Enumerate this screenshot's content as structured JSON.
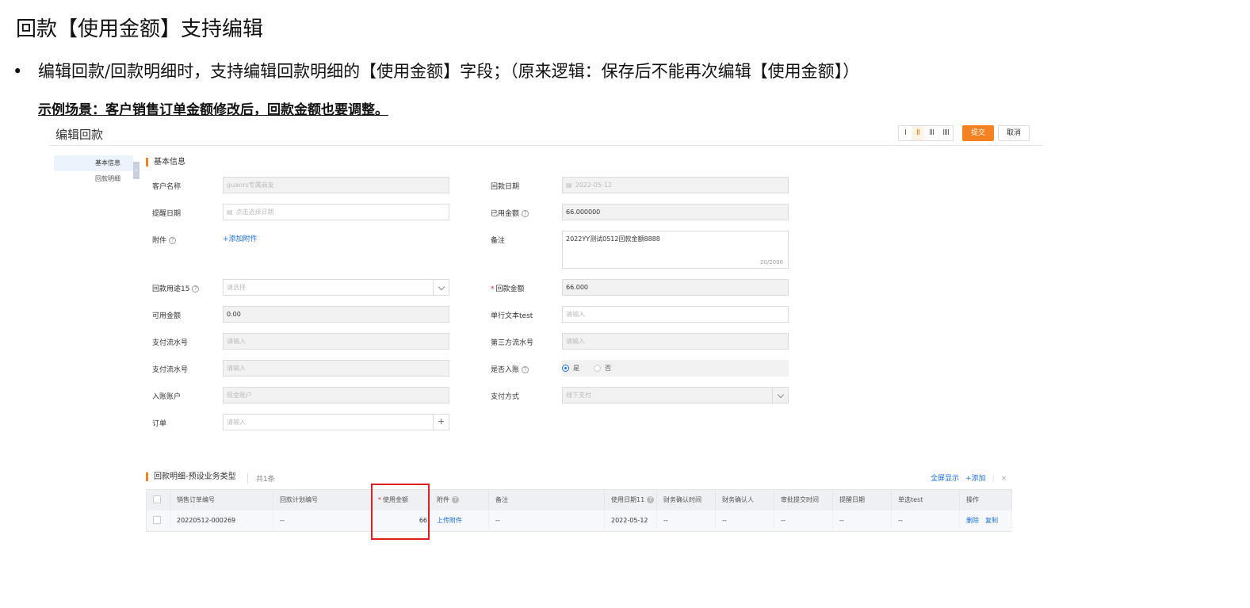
{
  "doc": {
    "title": "回款【使用金额】支持编辑",
    "bullet_symbol": "•",
    "bullet_text": "编辑回款/回款明细时，支持编辑回款明细的【使用金额】字段；（原来逻辑：保存后不能再次编辑【使用金额】）",
    "scenario": "示例场景：客户销售订单金额修改后，回款金额也要调整。"
  },
  "app": {
    "title": "编辑回款",
    "layout_options": [
      "I",
      "II",
      "III",
      "IIII"
    ],
    "submit_label": "提交",
    "cancel_label": "取消",
    "side_nav": [
      "基本信息",
      "回款明细"
    ],
    "collapse_glyph": "‹",
    "section_basic": "基本信息",
    "fields": {
      "customer_label": "客户名称",
      "customer_value": "guanrs专属商友",
      "payment_date_label": "回款日期",
      "payment_date_value": "2022-05-12",
      "remind_date_label": "提醒日期",
      "remind_date_placeholder": "点击选择日期",
      "used_amount_label": "已用金额",
      "used_amount_value": "66.000000",
      "attachment_label": "附件",
      "attachment_link": "+添加附件",
      "remark_label": "备注",
      "remark_value": "2022YY测试0512回款金额8888",
      "remark_count": "20/2000",
      "purpose_label": "回款用途15",
      "purpose_placeholder": "请选择",
      "amount_label": "回款金额",
      "amount_value": "66.000",
      "available_label": "可用金额",
      "available_value": "0.00",
      "single_text_label": "单行文本test",
      "single_text_placeholder": "请输入",
      "pay_serial_label": "支付流水号",
      "pay_serial_placeholder": "请输入",
      "third_serial_label": "第三方流水号",
      "third_serial_placeholder": "请输入",
      "pay_serial2_label": "支付流水号",
      "pay_serial2_placeholder": "请输入",
      "booked_label": "是否入账",
      "booked_yes": "是",
      "booked_no": "否",
      "account_label": "入账账户",
      "account_value": "现金账户",
      "pay_method_label": "支付方式",
      "pay_method_value": "线下支付",
      "order_label": "订单",
      "order_placeholder": "请输入",
      "order_add": "+"
    },
    "detail": {
      "title": "回款明细-预设业务类型",
      "count": "共1条",
      "fullscreen": "全屏显示",
      "add": "+添加",
      "close": "×",
      "columns": [
        "",
        "销售订单编号",
        "回款计划编号",
        "使用金额",
        "附件",
        "备注",
        "使用日期11",
        "财务确认时间",
        "财务确认人",
        "审批提交时间",
        "提醒日期",
        "单选test",
        "操作"
      ],
      "rows": [
        {
          "order_no": "20220512-000269",
          "plan_no": "--",
          "used_amount": "66",
          "attachment": "上传附件",
          "remark": "--",
          "use_date": "2022-05-12",
          "confirm_time": "--",
          "confirm_user": "--",
          "submit_time": "--",
          "remind_date": "--",
          "radio_test": "--",
          "op_delete": "删除",
          "op_copy": "复制"
        }
      ]
    }
  },
  "colors": {
    "accent": "#f58220",
    "link": "#1b6fdc",
    "highlight": "#e02020"
  }
}
